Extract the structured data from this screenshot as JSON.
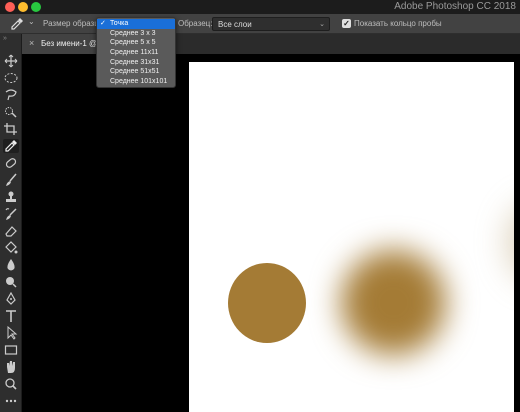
{
  "window": {
    "app_title": "Adobe Photoshop CC 2018"
  },
  "options_bar": {
    "sample_size_label": "Размер образца:",
    "sample_label": "Образец:",
    "sample_value": "Все слои",
    "show_ring_label": "Показать кольцо пробы",
    "show_ring_checked": true
  },
  "sample_size_menu": {
    "items": [
      "Точка",
      "Среднее 3 x 3",
      "Среднее 5 x 5",
      "Среднее 11x11",
      "Среднее 31x31",
      "Среднее 51x51",
      "Среднее 101x101"
    ],
    "selected": "Точка"
  },
  "document_tab": {
    "title": "Без имени-1 @"
  },
  "colors": {
    "swatch_brown": "#a47b35",
    "highlight": "#1a6fd8"
  },
  "tools": [
    "move-tool",
    "marquee-tool",
    "lasso-tool",
    "quick-selection-tool",
    "crop-tool",
    "eyedropper-tool",
    "healing-brush-tool",
    "brush-tool",
    "clone-stamp-tool",
    "history-brush-tool",
    "eraser-tool",
    "paint-bucket-tool",
    "blur-tool",
    "dodge-tool",
    "pen-tool",
    "type-tool",
    "path-selection-tool",
    "rectangle-tool",
    "hand-tool",
    "zoom-tool",
    "more-tools"
  ]
}
